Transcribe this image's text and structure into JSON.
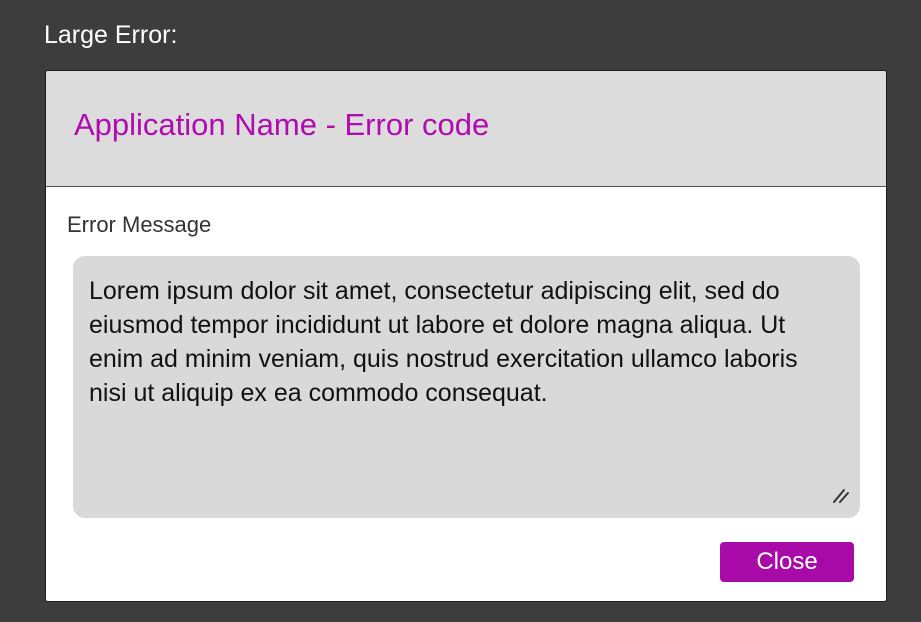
{
  "section_label": "Large Error:",
  "dialog": {
    "title": "Application Name - Error code",
    "message_label": "Error Message",
    "message": "Lorem ipsum dolor sit amet, consectetur adipiscing elit, sed do eiusmod tempor incididunt ut labore et dolore magna aliqua. Ut enim ad minim veniam, quis nostrud exercitation ullamco laboris nisi ut aliquip ex ea commodo consequat.",
    "close_label": "Close"
  },
  "icons": {
    "resize": "resize-handle-icon"
  },
  "colors": {
    "background": "#3d3d3d",
    "header_background": "#dcdcdc",
    "title_text": "#b00ab0",
    "message_box": "#d9d9d9",
    "button": "#a80aa8",
    "button_text": "#ffffff"
  }
}
